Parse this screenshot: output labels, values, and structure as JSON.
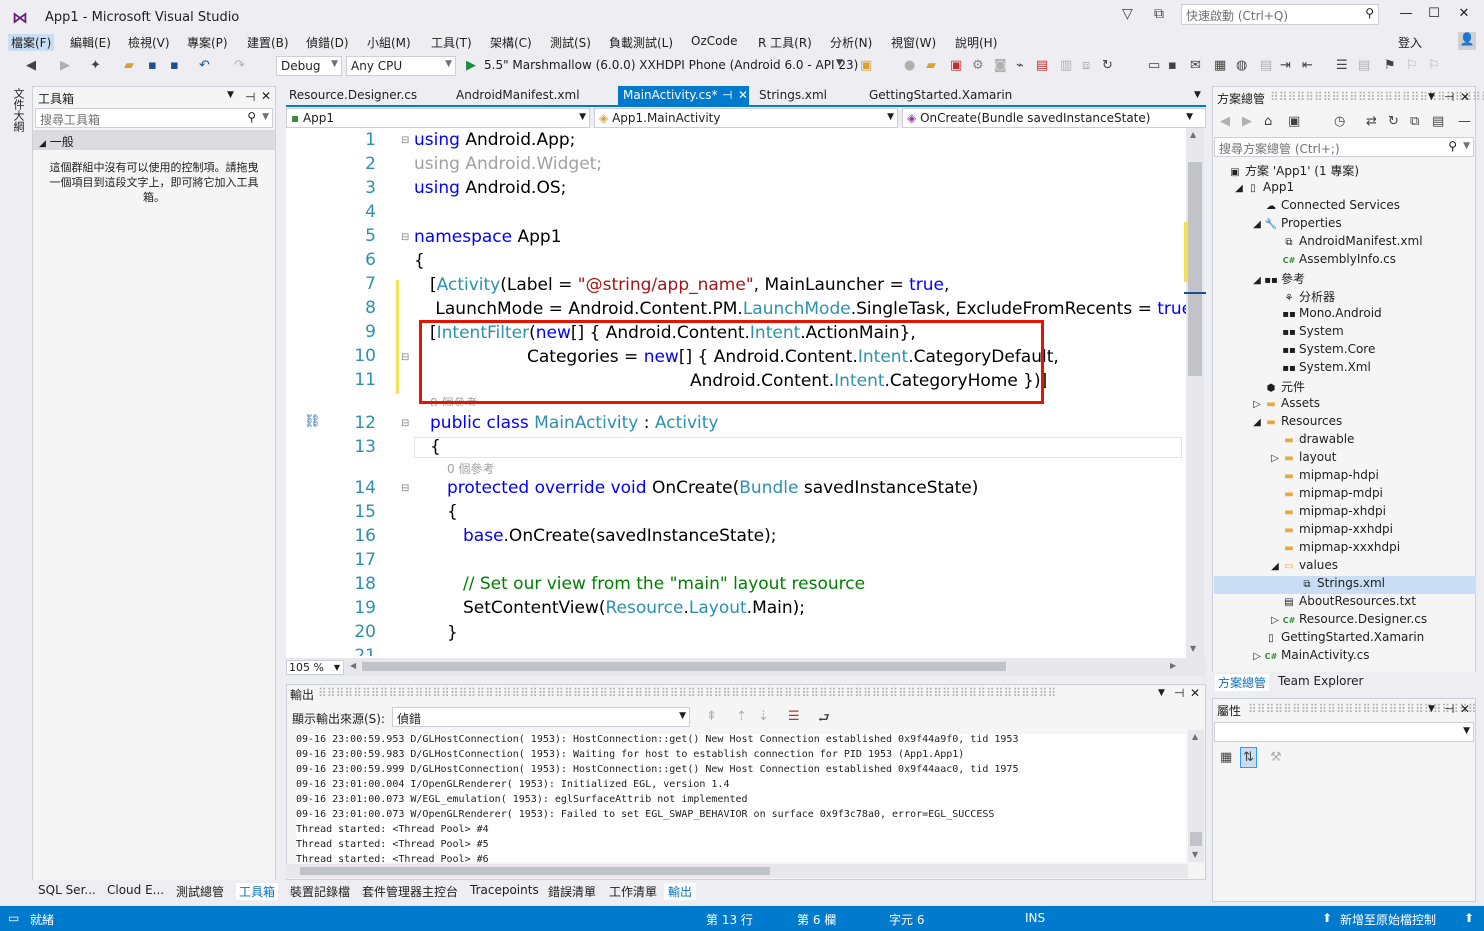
{
  "window": {
    "title": "App1 - Microsoft Visual Studio",
    "quick_launch": "快速啟動 (Ctrl+Q)",
    "login": "登入"
  },
  "menu": [
    "檔案(F)",
    "編輯(E)",
    "檢視(V)",
    "專案(P)",
    "建置(B)",
    "偵錯(D)",
    "小組(M)",
    "工具(T)",
    "架構(C)",
    "測試(S)",
    "負載測試(L)",
    "OzCode",
    "R 工具(R)",
    "分析(N)",
    "視窗(W)",
    "說明(H)"
  ],
  "toolbar": {
    "config": "Debug",
    "platform": "Any CPU",
    "run_target": "5.5\" Marshmallow (6.0.0) XXHDPI Phone (Android 6.0 - API 23)"
  },
  "left_strip": {
    "label": "文件大綱"
  },
  "toolbox": {
    "title": "工具箱",
    "search_placeholder": "搜尋工具箱",
    "group": "一般",
    "empty_message": "這個群組中沒有可以使用的控制項。請拖曳一個項目到這段文字上，即可將它加入工具箱。",
    "bottom_tabs": [
      "SQL Ser...",
      "Cloud E...",
      "測試總管",
      "工具箱"
    ]
  },
  "doc_tabs": [
    "Resource.Designer.cs",
    "AndroidManifest.xml",
    "MainActivity.cs*",
    "Strings.xml",
    "GettingStarted.Xamarin"
  ],
  "nav": {
    "project": "App1",
    "type": "App1.MainActivity",
    "member": "OnCreate(Bundle savedInstanceState)"
  },
  "editor": {
    "zoom": "105 %",
    "line_numbers": [
      "1",
      "2",
      "3",
      "4",
      "5",
      "6",
      "7",
      "8",
      "9",
      "10",
      "11",
      "12",
      "13",
      "14",
      "15",
      "16",
      "17",
      "18",
      "19",
      "20",
      "21"
    ],
    "refs_class": "0 個參考",
    "refs_method": "0 個參考",
    "lines": {
      "l1a": "using",
      "l1b": " Android.App;",
      "l2": "using Android.Widget;",
      "l3a": "using",
      "l3b": " Android.OS;",
      "l5a": "namespace",
      "l5b": " App1",
      "l6": "{",
      "l7a": "[",
      "l7b": "Activity",
      "l7c": "(Label = ",
      "l7d": "\"@string/app_name\"",
      "l7e": ", MainLauncher = ",
      "l7f": "true",
      "l7g": ",",
      "l8a": " LaunchMode = Android.Content.PM.",
      "l8b": "LaunchMode",
      "l8c": ".SingleTask, ExcludeFromRecents = ",
      "l8d": "true",
      "l8e": ")]",
      "l9a": "[",
      "l9b": "IntentFilter",
      "l9c": "(",
      "l9d": "new",
      "l9e": "[] { Android.Content.",
      "l9f": "Intent",
      "l9g": ".ActionMain},",
      "l10a": "Categories = ",
      "l10b": "new",
      "l10c": "[] { Android.Content.",
      "l10d": "Intent",
      "l10e": ".CategoryDefault,",
      "l11a": "Android.Content.",
      "l11b": "Intent",
      "l11c": ".CategoryHome })]",
      "l12a": "public class",
      "l12b": " ",
      "l12c": "MainActivity",
      "l12d": " : ",
      "l12e": "Activity",
      "l13": "{",
      "l14a": "protected override void",
      "l14b": " OnCreate(",
      "l14c": "Bundle",
      "l14d": " savedInstanceState)",
      "l15": "{",
      "l16a": "base",
      "l16b": ".OnCreate(savedInstanceState);",
      "l18": "// Set our view from the \"main\" layout resource",
      "l19a": "SetContentView(",
      "l19b": "Resource",
      "l19c": ".",
      "l19d": "Layout",
      "l19e": ".Main);",
      "l20": "}"
    }
  },
  "output": {
    "title": "輸出",
    "source_label": "顯示輸出來源(S):",
    "source_value": "偵錯",
    "lines": [
      "09-16 23:00:59.953 D/GLHostConnection( 1953): HostConnection::get() New Host Connection established 0x9f44a9f0, tid 1953",
      "09-16 23:00:59.983 D/GLHostConnection( 1953): Waiting for host to establish connection for PID 1953 (App1.App1)",
      "09-16 23:00:59.999 D/GLHostConnection( 1953): HostConnection::get() New Host Connection established 0x9f44aac0, tid 1975",
      "09-16 23:01:00.004 I/OpenGLRenderer( 1953): Initialized EGL, version 1.4",
      "09-16 23:01:00.073 W/EGL_emulation( 1953): eglSurfaceAttrib not implemented",
      "09-16 23:01:00.073 W/OpenGLRenderer( 1953): Failed to set EGL_SWAP_BEHAVIOR on surface 0x9f3c78a0, error=EGL_SUCCESS",
      "Thread started: <Thread Pool> #4",
      "Thread started: <Thread Pool> #5",
      "Thread started: <Thread Pool> #6"
    ]
  },
  "bottom_tabs": [
    "裝置記錄檔",
    "套件管理器主控台",
    "Tracepoints",
    "錯誤清單",
    "工作清單",
    "輸出"
  ],
  "solution": {
    "title": "方案總管",
    "search_placeholder": "搜尋方案總管 (Ctrl+;)",
    "items": [
      {
        "label": "方案 'App1' (1 專案)",
        "indent": 0,
        "icon": "solution-icon",
        "exp": ""
      },
      {
        "label": "App1",
        "indent": 1,
        "icon": "project-icon",
        "exp": "◢"
      },
      {
        "label": "Connected Services",
        "indent": 2,
        "icon": "cloud-icon",
        "exp": ""
      },
      {
        "label": "Properties",
        "indent": 2,
        "icon": "wrench-icon",
        "exp": "◢"
      },
      {
        "label": "AndroidManifest.xml",
        "indent": 3,
        "icon": "xml-file-icon",
        "exp": ""
      },
      {
        "label": "AssemblyInfo.cs",
        "indent": 3,
        "icon": "csharp-file-icon",
        "exp": ""
      },
      {
        "label": "參考",
        "indent": 2,
        "icon": "references-icon",
        "exp": "◢"
      },
      {
        "label": "分析器",
        "indent": 3,
        "icon": "analyzer-icon",
        "exp": ""
      },
      {
        "label": "Mono.Android",
        "indent": 3,
        "icon": "reference-icon",
        "exp": ""
      },
      {
        "label": "System",
        "indent": 3,
        "icon": "reference-icon",
        "exp": ""
      },
      {
        "label": "System.Core",
        "indent": 3,
        "icon": "reference-icon",
        "exp": ""
      },
      {
        "label": "System.Xml",
        "indent": 3,
        "icon": "reference-icon",
        "exp": ""
      },
      {
        "label": "元件",
        "indent": 2,
        "icon": "component-icon",
        "exp": ""
      },
      {
        "label": "Assets",
        "indent": 2,
        "icon": "folder-icon",
        "exp": "▷"
      },
      {
        "label": "Resources",
        "indent": 2,
        "icon": "folder-icon",
        "exp": "◢"
      },
      {
        "label": "drawable",
        "indent": 3,
        "icon": "folder-icon",
        "exp": ""
      },
      {
        "label": "layout",
        "indent": 3,
        "icon": "folder-icon",
        "exp": "▷"
      },
      {
        "label": "mipmap-hdpi",
        "indent": 3,
        "icon": "folder-icon",
        "exp": ""
      },
      {
        "label": "mipmap-mdpi",
        "indent": 3,
        "icon": "folder-icon",
        "exp": ""
      },
      {
        "label": "mipmap-xhdpi",
        "indent": 3,
        "icon": "folder-icon",
        "exp": ""
      },
      {
        "label": "mipmap-xxhdpi",
        "indent": 3,
        "icon": "folder-icon",
        "exp": ""
      },
      {
        "label": "mipmap-xxxhdpi",
        "indent": 3,
        "icon": "folder-icon",
        "exp": ""
      },
      {
        "label": "values",
        "indent": 3,
        "icon": "folder-open-icon",
        "exp": "◢"
      },
      {
        "label": "Strings.xml",
        "indent": 4,
        "icon": "xml-file-icon",
        "exp": "",
        "selected": true
      },
      {
        "label": "AboutResources.txt",
        "indent": 3,
        "icon": "text-file-icon",
        "exp": ""
      },
      {
        "label": "Resource.Designer.cs",
        "indent": 3,
        "icon": "csharp-file-icon",
        "exp": "▷"
      },
      {
        "label": "GettingStarted.Xamarin",
        "indent": 2,
        "icon": "file-icon",
        "exp": ""
      },
      {
        "label": "MainActivity.cs",
        "indent": 2,
        "icon": "csharp-file-icon",
        "exp": "▷"
      }
    ],
    "tabs": [
      "方案總管",
      "Team Explorer"
    ]
  },
  "properties": {
    "title": "屬性"
  },
  "status": {
    "ready": "就緒",
    "line": "第 13 行",
    "col": "第 6 欄",
    "ch": "字元 6",
    "ins": "INS",
    "publish": "新增至原始檔控制"
  },
  "colors": {
    "accent": "#007acc",
    "keyword": "#0000ff",
    "type": "#2b91af",
    "string": "#a31515",
    "comment": "#008000",
    "highlight_box": "#e51400"
  }
}
